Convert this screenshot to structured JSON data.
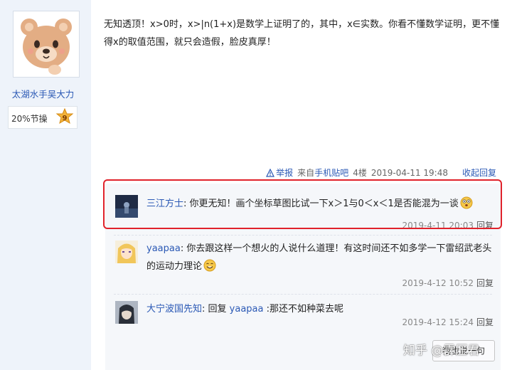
{
  "author": {
    "name": "太湖水手吴大力",
    "score_text": "20%节操",
    "level": "9"
  },
  "post": {
    "content": "无知透顶！x>0时，x>|n(1+x)是数学上证明了的，其中，x∈实数。你看不懂数学证明，更不懂得x的取值范围，就只会造假，脸皮真厚！",
    "report_label": "举报",
    "source_prefix": "来自",
    "source_link": "手机贴吧",
    "floor": "4楼",
    "time": "2019-04-11 19:48",
    "collapse_label": "收起回复"
  },
  "replies": [
    {
      "user": "三江方士",
      "separator": ": ",
      "text": "你更无知！画个坐标草图比试一下x＞1与0＜x＜1是否能混为一谈",
      "time": "2019-4-11 20:03",
      "reply_label": "回复",
      "emoji": "surprised-emoji"
    },
    {
      "user": "yaapaa",
      "separator": ": ",
      "text": "你去跟这样一个想火的人说什么道理！有这时间还不如多学一下雷绍武老头的运动力理论",
      "time": "2019-4-12 10:52",
      "reply_label": "回复",
      "emoji": "smile-emoji"
    },
    {
      "user": "大宁波国先知",
      "separator": ": ",
      "reply_prefix": "回复 ",
      "reply_target": "yaapaa",
      "text": " :那还不如种菜去呢",
      "time": "2019-4-12 15:24",
      "reply_label": "回复"
    }
  ],
  "say_button_label": "我也说一句",
  "watermark": "知乎 @霹压君",
  "colors": {
    "link": "#2b59b5",
    "highlight_border": "#e0222b",
    "sidebar_bg": "#eef3fa",
    "reply_bg": "#f5f7fa"
  }
}
